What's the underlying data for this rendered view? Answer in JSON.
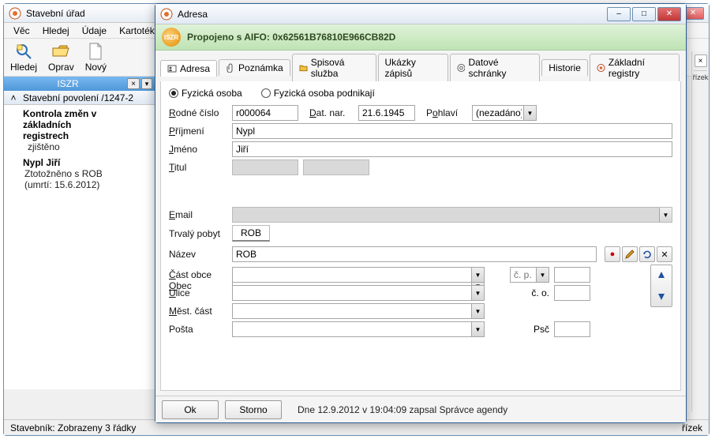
{
  "parent": {
    "title": "Stavební úřad",
    "menu": [
      "Věc",
      "Hledej",
      "Údaje",
      "Kartotéky"
    ],
    "toolbar": {
      "hledej": "Hledej",
      "oprav": "Oprav",
      "novy": "Nový"
    },
    "iszr_label": "ISZR",
    "sidebar_header": "Stavební povolení /1247-2",
    "sidebar_header_chev": "˄",
    "sidebar_items": [
      {
        "line1": "Kontrola změn v",
        "sub1": "základních",
        "sub2": "registrech",
        "sub3": "zjištěno"
      },
      {
        "line1": "Nypl Jiří",
        "sub1": "Ztotožněno s ROB",
        "sub2": "(umrtí: 15.6.2012)",
        "sub3": ""
      }
    ],
    "status_left": "Stavebník: Zobrazeny 3 řádky",
    "status_right": "řízek"
  },
  "modal": {
    "title": "Adresa",
    "ribbon_badge": "ISZR",
    "ribbon_text": "Propojeno s AIFO: 0x62561B76810E966CB82D",
    "tabs": {
      "adresa": "Adresa",
      "poznamka": "Poznámka",
      "spisova": "Spisová služba",
      "ukazky": "Ukázky zápisů",
      "datove": "Datové schránky",
      "historie": "Historie",
      "zakladni": "Základní registry"
    },
    "radios": {
      "fyzicka": "Fyzická osoba",
      "podnikajici": "Fyzická osoba podnikají"
    },
    "labels": {
      "rodne": "Rodné číslo",
      "datnar": "Dat. nar.",
      "pohlavi": "Pohlaví",
      "prijmeni": "Příjmení",
      "jmeno": "Jméno",
      "titul": "Titul",
      "email": "Email",
      "trvaly": "Trvalý pobyt",
      "nazev": "Název",
      "obec": "Obec",
      "cast": "Část obce",
      "ulice": "Ulice",
      "mest": "Měst. část",
      "posta": "Pošta",
      "cp": "č. p.",
      "co": "č. o.",
      "psc": "Psč"
    },
    "values": {
      "rodne": "r000064",
      "datnar": "21.6.1945",
      "pohlavi": "(nezadáno)",
      "prijmeni": "Nypl",
      "jmeno": "Jiří",
      "titul1": "",
      "titul2": "",
      "email": "",
      "trvaly": "ROB",
      "nazev": "ROB",
      "obec": "",
      "cast": "",
      "ulice": "",
      "mest": "",
      "posta": "",
      "cp_type": "",
      "cp": "",
      "co": "",
      "psc": ""
    },
    "footer": {
      "ok": "Ok",
      "storno": "Storno",
      "msg": "Dne 12.9.2012 v 19:04:09 zapsal Správce agendy"
    }
  },
  "win_icons": {
    "min": "–",
    "max": "□",
    "close": "✕"
  }
}
